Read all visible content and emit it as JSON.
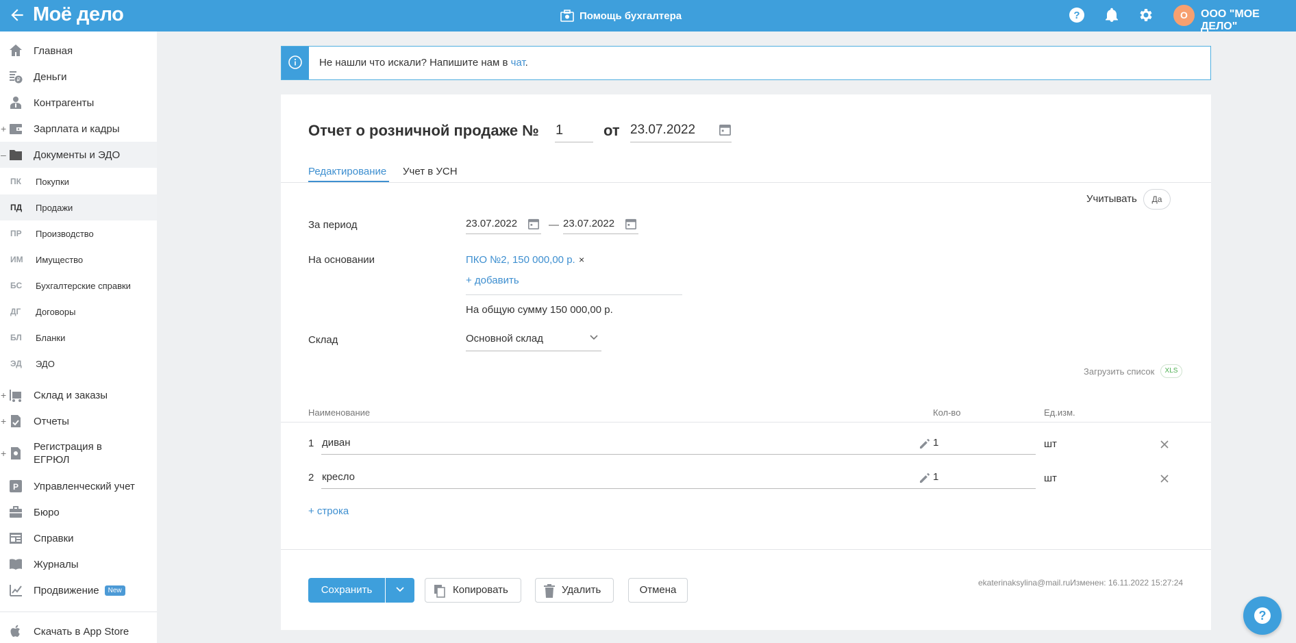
{
  "header": {
    "logo": "Моё дело",
    "helper_label": "Помощь бухгалтера",
    "org_initial": "О",
    "org_name": "ООО \"МОЕ ДЕЛО\""
  },
  "sidebar": {
    "items": [
      {
        "label": "Главная",
        "icon": "home-icon"
      },
      {
        "label": "Деньги",
        "icon": "money-icon"
      },
      {
        "label": "Контрагенты",
        "icon": "contractors-icon"
      },
      {
        "label": "Зарплата и кадры",
        "icon": "wallet-icon"
      },
      {
        "label": "Документы и ЭДО",
        "icon": "folder-icon"
      },
      {
        "label": "Склад и заказы",
        "icon": "warehouse-icon"
      },
      {
        "label": "Отчеты",
        "icon": "reports-icon"
      },
      {
        "label": "Регистрация в ЕГРЮЛ",
        "icon": "registration-icon"
      },
      {
        "label": "Управленческий учет",
        "icon": "management-icon"
      },
      {
        "label": "Бюро",
        "icon": "briefcase-icon"
      },
      {
        "label": "Справки",
        "icon": "references-icon"
      },
      {
        "label": "Журналы",
        "icon": "journals-icon"
      },
      {
        "label": "Продвижение",
        "icon": "promotion-icon",
        "badge": "New"
      },
      {
        "label": "Скачать в App Store",
        "icon": "apple-icon"
      }
    ],
    "subitems": [
      {
        "abbr": "ПК",
        "label": "Покупки"
      },
      {
        "abbr": "ПД",
        "label": "Продажи"
      },
      {
        "abbr": "ПР",
        "label": "Производство"
      },
      {
        "abbr": "ИМ",
        "label": "Имущество"
      },
      {
        "abbr": "БС",
        "label": "Бухгалтерские справки"
      },
      {
        "abbr": "ДГ",
        "label": "Договоры"
      },
      {
        "abbr": "БЛ",
        "label": "Бланки"
      },
      {
        "abbr": "ЭД",
        "label": "ЭДО"
      }
    ]
  },
  "banner": {
    "text": "Не нашли что искали? Напишите нам в ",
    "link": "чат",
    "tail": "."
  },
  "document": {
    "title": "Отчет о розничной продаже №",
    "number": "1",
    "from_label": "от",
    "date": "23.07.2022",
    "tabs": [
      "Редактирование",
      "Учет в УСН"
    ],
    "account_label": "Учитывать",
    "account_value": "Да",
    "period_label": "За период",
    "period_from": "23.07.2022",
    "period_to": "23.07.2022",
    "basis_label": "На основании",
    "basis_link": "ПКО №2, 150 000,00 р.",
    "basis_remove": "×",
    "add_basis": "+ добавить",
    "total": "На общую сумму 150 000,00 р.",
    "warehouse_label": "Склад",
    "warehouse_value": "Основной склад",
    "upload_label": "Загрузить список",
    "upload_badge": "XLS"
  },
  "table": {
    "headers": {
      "name": "Наименование",
      "qty": "Кол-во",
      "unit": "Ед.изм."
    },
    "rows": [
      {
        "num": "1",
        "name": "диван",
        "qty": "1",
        "unit": "шт"
      },
      {
        "num": "2",
        "name": "кресло",
        "qty": "1",
        "unit": "шт"
      }
    ],
    "add_row": "+ строка"
  },
  "footer": {
    "save": "Сохранить",
    "copy": "Копировать",
    "delete": "Удалить",
    "cancel": "Отмена",
    "modified": "ekaterinaksylina@mail.ruИзменен: 16.11.2022 15:27:24"
  },
  "colors": {
    "accent": "#3e9fdc",
    "link": "#3e8fd0"
  }
}
